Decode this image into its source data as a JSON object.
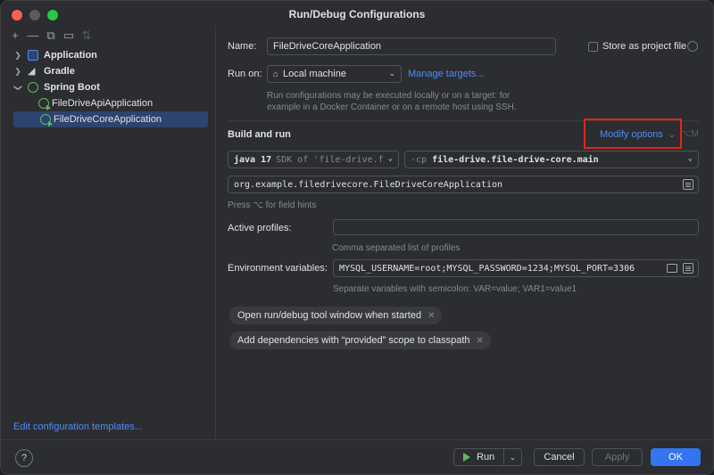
{
  "window": {
    "title": "Run/Debug Configurations"
  },
  "sidebar": {
    "toolbar": [
      {
        "icon": "add-icon",
        "glyph": "+"
      },
      {
        "icon": "remove-icon",
        "glyph": "—"
      },
      {
        "icon": "copy-icon",
        "glyph": "⧉"
      },
      {
        "icon": "new-folder-icon",
        "glyph": "▭"
      },
      {
        "icon": "sort-icon",
        "glyph": "⇅"
      }
    ],
    "tree": [
      {
        "label": "Application",
        "level": 0,
        "icon": "application-icon",
        "expanded": false
      },
      {
        "label": "Gradle",
        "level": 0,
        "icon": "gradle-icon",
        "expanded": false
      },
      {
        "label": "Spring Boot",
        "level": 0,
        "icon": "spring-boot-icon",
        "expanded": true
      },
      {
        "label": "FileDriveApiApplication",
        "level": 1,
        "icon": "spring-run-icon",
        "selected": false
      },
      {
        "label": "FileDriveCoreApplication",
        "level": 1,
        "icon": "spring-run-icon",
        "selected": true
      }
    ],
    "edit_templates": "Edit configuration templates..."
  },
  "form": {
    "name_label": "Name:",
    "name_value": "FileDriveCoreApplication",
    "store_label": "Store as project file",
    "store_checked": false,
    "run_on_label": "Run on:",
    "run_on_value": "Local machine",
    "manage_targets": "Manage targets...",
    "run_on_hint_1": "Run configurations may be executed locally or on a target: for",
    "run_on_hint_2": "example in a Docker Container or on a remote host using SSH.",
    "build_run_label": "Build and run",
    "modify_options": "Modify options",
    "modify_shortcut": "⌥M",
    "jdk_value": "java 17",
    "jdk_hint": "SDK of 'file-drive.f",
    "cp_prefix": "-cp",
    "cp_value": "file-drive.file-drive-core.main",
    "main_class": "org.example.filedrivecore.FileDriveCoreApplication",
    "field_hint": "Press ⌥ for field hints",
    "profiles_label": "Active profiles:",
    "profiles_value": "",
    "profiles_hint": "Comma separated list of profiles",
    "env_label": "Environment variables:",
    "env_value": "MYSQL_USERNAME=root;MYSQL_PASSWORD=1234;MYSQL_PORT=3306",
    "env_hint": "Separate variables with semicolon: VAR=value; VAR1=value1",
    "tags": [
      "Open run/debug tool window when started",
      "Add dependencies with “provided” scope to classpath"
    ]
  },
  "footer": {
    "help": "?",
    "run": "Run",
    "cancel": "Cancel",
    "apply": "Apply",
    "ok": "OK"
  },
  "colors": {
    "accent": "#3574f0",
    "link": "#548af7",
    "highlight_box": "#e3251b",
    "selection": "#2e436e"
  }
}
